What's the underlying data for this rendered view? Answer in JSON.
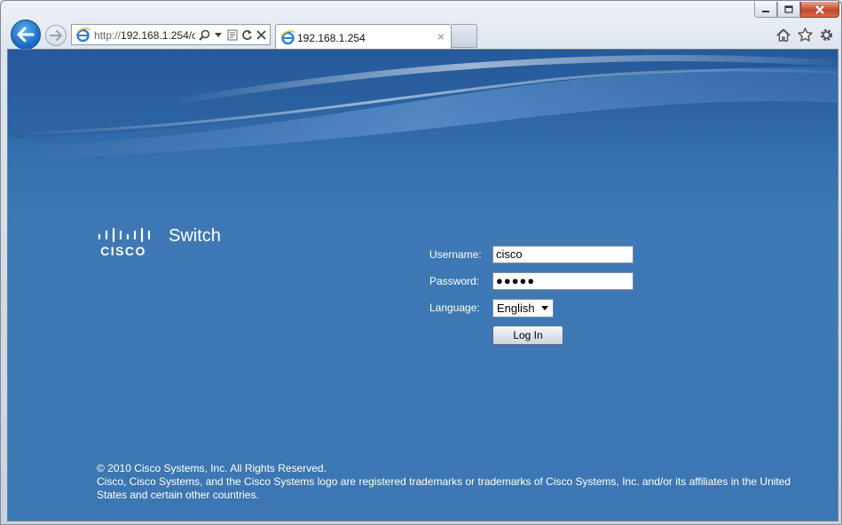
{
  "browser": {
    "address": {
      "protocol": "http://",
      "host": "192.168.1.254/c"
    },
    "tab": {
      "title": "192.168.1.254",
      "close": "×"
    },
    "icons": [
      "back-arrow-icon",
      "forward-arrow-icon",
      "ie-icon",
      "search-icon",
      "dropdown-icon",
      "compatibility-icon",
      "refresh-icon",
      "stop-icon",
      "home-icon",
      "favorites-star-icon",
      "settings-gear-icon",
      "minimize-icon",
      "maximize-icon",
      "close-icon"
    ]
  },
  "page": {
    "logo_text": "CISCO",
    "product_name": "Switch",
    "form": {
      "username_label": "Username:",
      "username_value": "cisco",
      "password_label": "Password:",
      "password_value": "●●●●●",
      "language_label": "Language:",
      "language_value": "English",
      "login_label": "Log In"
    },
    "footer": {
      "copyright": "© 2010 Cisco Systems, Inc. All Rights Reserved.",
      "trademark": "Cisco, Cisco Systems, and the Cisco Systems logo are registered trademarks or trademarks of Cisco Systems, Inc. and/or its affiliates in the United States and certain other countries."
    }
  },
  "colors": {
    "page_background": "#3d77b3",
    "text": "#ffffff"
  }
}
